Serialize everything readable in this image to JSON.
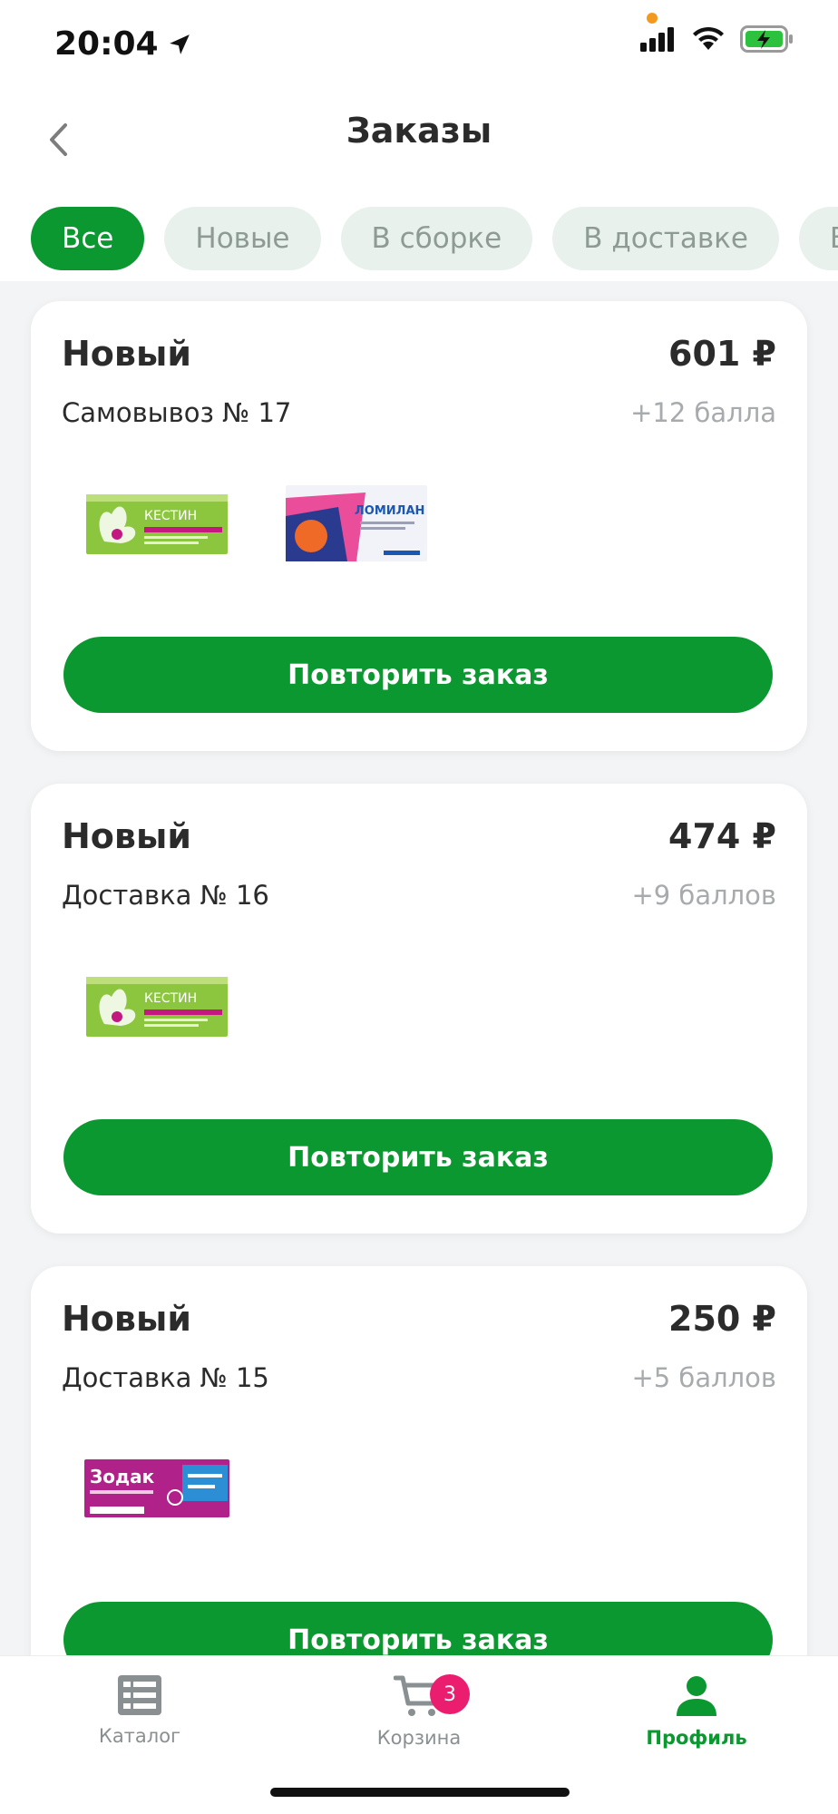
{
  "status_bar": {
    "time": "20:04"
  },
  "header": {
    "title": "Заказы"
  },
  "tabs": [
    {
      "label": "Все",
      "active": true
    },
    {
      "label": "Новые",
      "active": false
    },
    {
      "label": "В сборке",
      "active": false
    },
    {
      "label": "В доставке",
      "active": false
    },
    {
      "label": "Вы",
      "active": false
    }
  ],
  "orders": [
    {
      "status": "Новый",
      "price": "601 ₽",
      "type": "Самовывоз № 17",
      "bonus": "+12 балла",
      "products": [
        {
          "name": "КЕСТИН",
          "icon": "kestin-box"
        },
        {
          "name": "ЛОМИЛАН",
          "icon": "lomilan-box"
        }
      ],
      "button": "Повторить заказ"
    },
    {
      "status": "Новый",
      "price": "474 ₽",
      "type": "Доставка № 16",
      "bonus": "+9 баллов",
      "products": [
        {
          "name": "КЕСТИН",
          "icon": "kestin-box"
        }
      ],
      "button": "Повторить заказ"
    },
    {
      "status": "Новый",
      "price": "250 ₽",
      "type": "Доставка № 15",
      "bonus": "+5 баллов",
      "products": [
        {
          "name": "Зодак",
          "icon": "zodak-box"
        }
      ],
      "button": "Повторить заказ"
    }
  ],
  "bottom_nav": [
    {
      "label": "Каталог",
      "icon": "list-icon",
      "active": false
    },
    {
      "label": "Корзина",
      "icon": "cart-icon",
      "active": false,
      "badge": "3"
    },
    {
      "label": "Профиль",
      "icon": "person-icon",
      "active": true
    }
  ],
  "colors": {
    "accent": "#0b9830",
    "tab_inactive_bg": "#e8f1ec",
    "badge": "#ea1d6f",
    "muted_text": "#a7abad"
  }
}
